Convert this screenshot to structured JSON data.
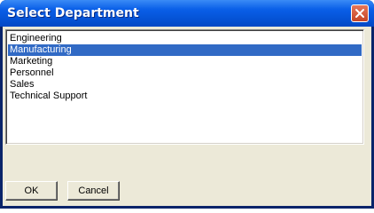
{
  "window": {
    "title": "Select Department",
    "close_label": "×"
  },
  "departments": {
    "items": [
      {
        "label": "Engineering",
        "selected": false
      },
      {
        "label": "Manufacturing",
        "selected": true
      },
      {
        "label": "Marketing",
        "selected": false
      },
      {
        "label": "Personnel",
        "selected": false
      },
      {
        "label": "Sales",
        "selected": false
      },
      {
        "label": "Technical Support",
        "selected": false
      }
    ]
  },
  "buttons": {
    "ok_label": "OK",
    "cancel_label": "Cancel"
  },
  "colors": {
    "selection": "#316ac5",
    "titlebar": "#0553d6",
    "client": "#ece9d8",
    "close": "#c54526"
  }
}
